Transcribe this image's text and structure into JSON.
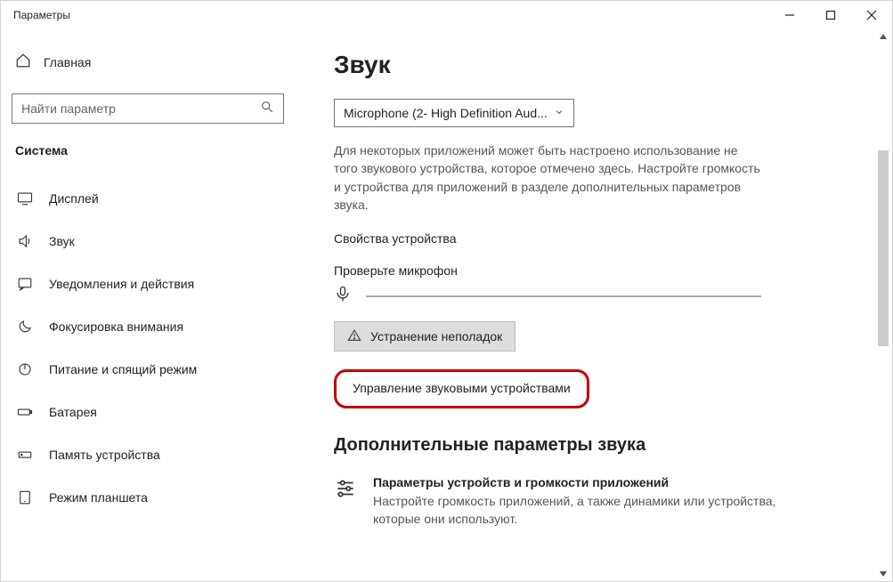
{
  "window": {
    "title": "Параметры"
  },
  "sidebar": {
    "home_label": "Главная",
    "search_placeholder": "Найти параметр",
    "section_heading": "Система",
    "items": [
      {
        "label": "Дисплей"
      },
      {
        "label": "Звук"
      },
      {
        "label": "Уведомления и действия"
      },
      {
        "label": "Фокусировка внимания"
      },
      {
        "label": "Питание и спящий режим"
      },
      {
        "label": "Батарея"
      },
      {
        "label": "Память устройства"
      },
      {
        "label": "Режим планшета"
      }
    ]
  },
  "main": {
    "title": "Звук",
    "input_device": "Microphone (2- High Definition Aud...",
    "body_text": "Для некоторых приложений может быть настроено использование не того звукового устройства, которое отмечено здесь. Настройте громкость и устройства для приложений в разделе дополнительных параметров звука.",
    "device_props_link": "Свойства устройства",
    "mic_check_label": "Проверьте микрофон",
    "troubleshoot_label": "Устранение неполадок",
    "manage_devices_link": "Управление звуковыми устройствами",
    "advanced_heading": "Дополнительные параметры звука",
    "adv_tile": {
      "title": "Параметры устройств и громкости приложений",
      "sub": "Настройте громкость приложений, а также динамики или устройства, которые они используют."
    }
  }
}
